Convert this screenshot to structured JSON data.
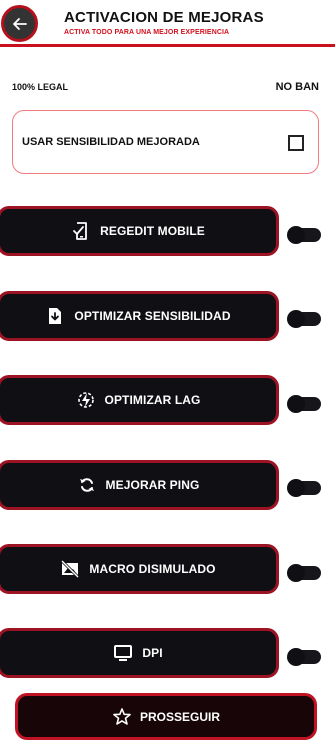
{
  "header": {
    "back_icon": "arrow-left-icon",
    "title": "ACTIVACION DE MEJORAS",
    "subtitle": "ACTIVA TODO  PARA UNA MEJOR EXPERIENCIA"
  },
  "status": {
    "legal": "100% LEGAL",
    "no_ban": "NO BAN"
  },
  "sensitivity": {
    "label": "USAR SENSIBILIDAD MEJORADA",
    "checked": false
  },
  "options": [
    {
      "label": "REGEDIT MOBILE",
      "icon": "phone-check-icon",
      "enabled": false
    },
    {
      "label": "OPTIMIZAR SENSIBILIDAD",
      "icon": "file-download-icon",
      "enabled": false
    },
    {
      "label": "OPTIMIZAR LAG",
      "icon": "lightning-gear-icon",
      "enabled": false
    },
    {
      "label": "MEJORAR PING",
      "icon": "refresh-icon",
      "enabled": false
    },
    {
      "label": "MACRO DISIMULADO",
      "icon": "image-off-icon",
      "enabled": false
    },
    {
      "label": "DPI",
      "icon": "monitor-icon",
      "enabled": false
    }
  ],
  "proceed": {
    "label": "PROSSEGUIR",
    "icon": "star-icon"
  },
  "colors": {
    "accent_red": "#c8101e",
    "button_dark": "#0f0f14",
    "button_border": "#9c1424",
    "card_border": "#f07c80"
  }
}
